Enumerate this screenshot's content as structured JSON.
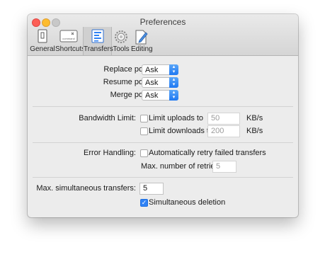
{
  "window": {
    "title": "Preferences"
  },
  "toolbar": {
    "items": [
      {
        "label": "General",
        "icon": "general-icon"
      },
      {
        "label": "Shortcuts",
        "icon": "shortcuts-icon",
        "key_text": "command"
      },
      {
        "label": "Transfers",
        "icon": "transfers-icon",
        "selected": true
      },
      {
        "label": "Tools",
        "icon": "gear-icon"
      },
      {
        "label": "Editing",
        "icon": "edit-icon"
      }
    ]
  },
  "policies": {
    "replace": {
      "label": "Replace policy:",
      "value": "Ask"
    },
    "resume": {
      "label": "Resume policy:",
      "value": "Ask"
    },
    "merge": {
      "label": "Merge policy:",
      "value": "Ask"
    }
  },
  "bandwidth": {
    "label": "Bandwidth Limit:",
    "uploads": {
      "label": "Limit uploads to",
      "checked": false,
      "value": "50",
      "unit": "KB/s"
    },
    "downloads": {
      "label": "Limit downloads to",
      "checked": false,
      "value": "200",
      "unit": "KB/s"
    }
  },
  "errors": {
    "label": "Error Handling:",
    "retry": {
      "label": "Automatically retry failed transfers",
      "checked": false
    },
    "max_retries": {
      "label": "Max. number of retries:",
      "value": "5"
    }
  },
  "simultaneous": {
    "label": "Max. simultaneous transfers:",
    "value": "5",
    "deletion": {
      "label": "Simultaneous deletion",
      "checked": true
    }
  },
  "colors": {
    "accent": "#2f82f5",
    "window_bg": "#ececec"
  }
}
